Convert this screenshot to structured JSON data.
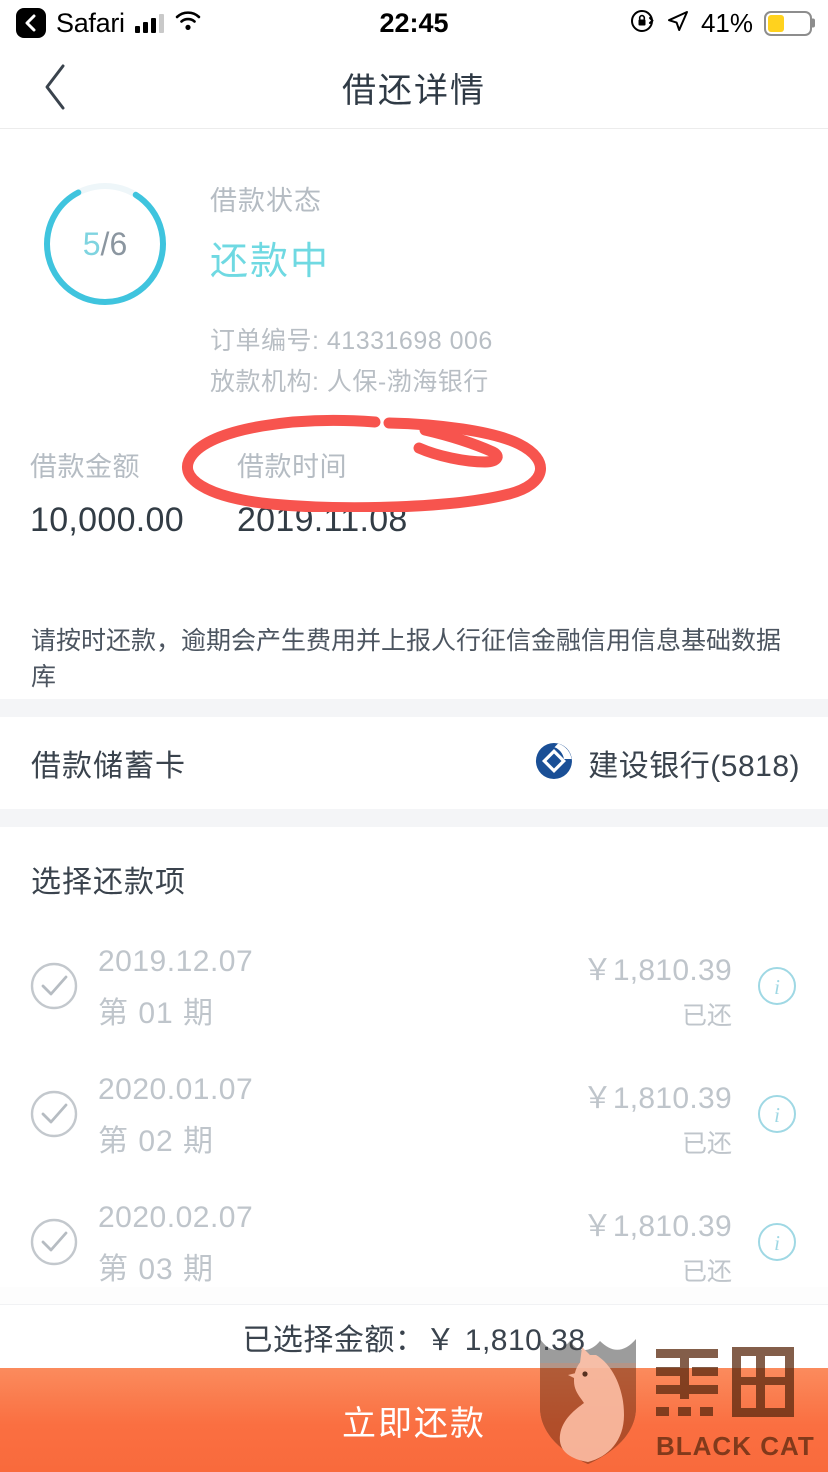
{
  "status_bar": {
    "carrier_app": "Safari",
    "time": "22:45",
    "battery_percent": "41%",
    "battery_level": 41,
    "icons": [
      "back-chip-icon",
      "signal-bars-icon",
      "wifi-icon",
      "rotation-lock-icon",
      "location-arrow-icon",
      "battery-icon"
    ]
  },
  "nav": {
    "title": "借还详情",
    "back_icon": "chevron-left-icon"
  },
  "hero": {
    "progress_current": "5",
    "progress_separator": "/",
    "progress_total": "6",
    "progress_done": 5,
    "progress_of": 6,
    "status_label": "借款状态",
    "status_value": "还款中",
    "order_no": "订单编号: 41331698          006",
    "lender": "放款机构: 人保-渤海银行",
    "ring_color": "#3fc4de",
    "status_color": "#6fd9e2"
  },
  "annotation": {
    "color": "#f7544e",
    "shape": "hand-drawn-ellipse"
  },
  "amounts": [
    {
      "label": "借款金额",
      "value": "10,000.00"
    },
    {
      "label": "借款时间",
      "value": "2019.11.08"
    }
  ],
  "notice": "请按时还款，逾期会产生费用并上报人行征信金融信用信息基础数据库",
  "bank": {
    "label": "借款储蓄卡",
    "name": "建设银行(5818)",
    "logo_icon": "ccb-bank-logo-icon",
    "logo_color": "#1a4f96"
  },
  "repay": {
    "section_title": "选择还款项",
    "items": [
      {
        "date": "2019.12.07",
        "term": "第 01 期",
        "amount": "￥1,810.39",
        "state": "已还",
        "checked": true
      },
      {
        "date": "2020.01.07",
        "term": "第 02 期",
        "amount": "￥1,810.39",
        "state": "已还",
        "checked": true
      },
      {
        "date": "2020.02.07",
        "term": "第 03 期",
        "amount": "￥1,810.39",
        "state": "已还",
        "checked": true
      }
    ],
    "check_icon": "check-circle-icon",
    "info_icon": "info-circle-icon",
    "info_color": "#9fd8e4"
  },
  "bottom": {
    "selected_label": "已选择金额：￥ 1,810.38",
    "pay_button": "立即还款",
    "button_color": "#fa7044"
  },
  "watermark": {
    "cn": "黑猫",
    "en": "BLACK CAT",
    "icon": "black-cat-shield-icon"
  }
}
